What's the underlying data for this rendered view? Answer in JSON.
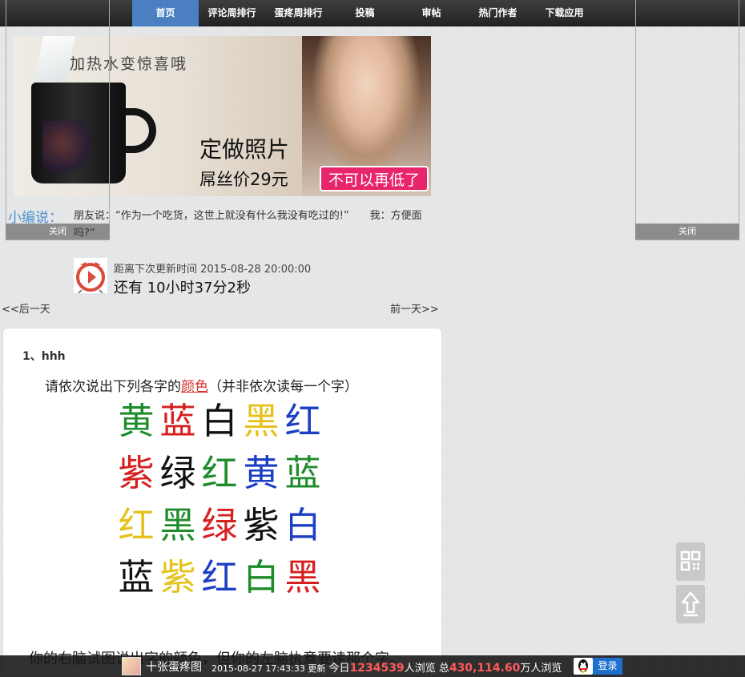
{
  "nav": {
    "items": [
      {
        "label": "首页",
        "active": true
      },
      {
        "label": "评论周排行"
      },
      {
        "label": "蛋疼周排行"
      },
      {
        "label": "投稿"
      },
      {
        "label": "审帖"
      },
      {
        "label": "热门作者"
      },
      {
        "label": "下载应用"
      }
    ]
  },
  "side_panels": {
    "left_close": "关闭",
    "right_close": "关闭"
  },
  "banner": {
    "slogan": "加热水变惊喜哦",
    "title": "定做照片",
    "price": "屌丝价29元",
    "tag": "不可以再低了"
  },
  "editor": {
    "label": "小编说：",
    "text": "朋友说：“作为一个吃货，这世上就没有什么我没有吃过的!”　　我：方便面吗?”"
  },
  "countdown": {
    "label": "距离下次更新时间 2015-08-28 20:00:00",
    "value": "还有 10小时37分2秒"
  },
  "pagination": {
    "prev": "<<后一天",
    "next": "前一天>>"
  },
  "post": {
    "title": "1、hhh",
    "image": {
      "instruction_before": "请依次说出下列各字的",
      "instruction_highlight": "颜色",
      "instruction_after": "（并非依次读每一个字）",
      "grid": [
        [
          {
            "char": "黄",
            "color": "#1e8c2a"
          },
          {
            "char": "蓝",
            "color": "#d62020"
          },
          {
            "char": "白",
            "color": "#111111"
          },
          {
            "char": "黑",
            "color": "#e5c21c"
          },
          {
            "char": "红",
            "color": "#1c3fc4"
          }
        ],
        [
          {
            "char": "紫",
            "color": "#d62020"
          },
          {
            "char": "绿",
            "color": "#111111"
          },
          {
            "char": "红",
            "color": "#1e8c2a"
          },
          {
            "char": "黄",
            "color": "#1c3fc4"
          },
          {
            "char": "蓝",
            "color": "#1e8c2a"
          }
        ],
        [
          {
            "char": "红",
            "color": "#e5c21c"
          },
          {
            "char": "黑",
            "color": "#1e8c2a"
          },
          {
            "char": "绿",
            "color": "#d62020"
          },
          {
            "char": "紫",
            "color": "#111111"
          },
          {
            "char": "白",
            "color": "#1c3fc4"
          }
        ],
        [
          {
            "char": "蓝",
            "color": "#111111"
          },
          {
            "char": "紫",
            "color": "#e5c21c"
          },
          {
            "char": "红",
            "color": "#1c3fc4"
          },
          {
            "char": "白",
            "color": "#1e8c2a"
          },
          {
            "char": "黑",
            "color": "#d62020"
          }
        ]
      ]
    },
    "caption": "你的右脑试图说出字的颜色，但你的左脑执意要读那个字。"
  },
  "float_buttons": {
    "qr_icon": "qr-code-icon",
    "top_icon": "arrow-up-icon"
  },
  "bottombar": {
    "site_name": "十张蛋疼图",
    "update_time": "2015-08-27 17:43:33 更新",
    "today_prefix": "今日",
    "today_count": "1234539",
    "today_suffix": "人浏览 总",
    "total_count": "430,114.60",
    "total_suffix": "万人浏览",
    "login": "登录"
  }
}
